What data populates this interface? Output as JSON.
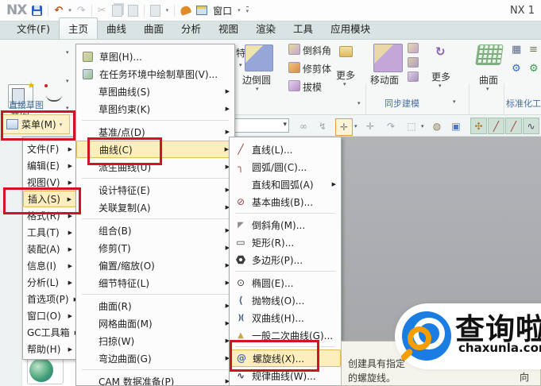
{
  "titlebar": {
    "logo": "NX",
    "window_label": "窗口",
    "right_text": "NX 1"
  },
  "tabs": [
    {
      "label": "文件(F)"
    },
    {
      "label": "主页",
      "active": true
    },
    {
      "label": "曲线"
    },
    {
      "label": "曲面"
    },
    {
      "label": "分析"
    },
    {
      "label": "视图"
    },
    {
      "label": "渲染"
    },
    {
      "label": "工具"
    },
    {
      "label": "应用模块"
    }
  ],
  "ribbon": {
    "sketch": "草图",
    "direct_sketch_group": "直接草图",
    "feature_partial": "特征",
    "edge_blend": "边倒圆",
    "chamfer": "倒斜角",
    "trim_body": "修剪体",
    "draft": "拔模",
    "more": "更多",
    "move_face": "移动面",
    "more2": "更多",
    "sync_group": "同步建模",
    "surface": "曲面",
    "std_group": "标准化工具"
  },
  "menu_button": "菜单(M)",
  "main_menu": {
    "items": [
      {
        "label": "文件(F)",
        "arrow": true
      },
      {
        "label": "编辑(E)",
        "arrow": true
      },
      {
        "label": "视图(V)",
        "arrow": true
      },
      {
        "label": "插入(S)",
        "arrow": true,
        "highlight": true
      },
      {
        "label": "格式(R)",
        "arrow": true
      },
      {
        "label": "工具(T)",
        "arrow": true
      },
      {
        "label": "装配(A)",
        "arrow": true
      },
      {
        "label": "信息(I)",
        "arrow": true
      },
      {
        "label": "分析(L)",
        "arrow": true
      },
      {
        "label": "首选项(P)",
        "arrow": true
      },
      {
        "label": "窗口(O)",
        "arrow": true
      },
      {
        "label": "GC工具箱",
        "arrow": true
      },
      {
        "label": "帮助(H)",
        "arrow": true
      }
    ]
  },
  "insert_menu": {
    "items": [
      {
        "label": "草图(H)...",
        "icon": "sketch"
      },
      {
        "label": "在任务环境中绘制草图(V)...",
        "icon": "sketch-task"
      },
      {
        "label": "草图曲线(S)",
        "arrow": true
      },
      {
        "label": "草图约束(K)",
        "arrow": true
      },
      {
        "type": "separator"
      },
      {
        "label": "基准/点(D)",
        "arrow": true
      },
      {
        "label": "曲线(C)",
        "arrow": true,
        "highlight": true
      },
      {
        "label": "派生曲线(U)",
        "arrow": true
      },
      {
        "type": "separator"
      },
      {
        "label": "设计特征(E)",
        "arrow": true
      },
      {
        "label": "关联复制(A)",
        "arrow": true
      },
      {
        "type": "separator"
      },
      {
        "label": "组合(B)",
        "arrow": true
      },
      {
        "label": "修剪(T)",
        "arrow": true
      },
      {
        "label": "偏置/缩放(O)",
        "arrow": true
      },
      {
        "label": "细节特征(L)",
        "arrow": true
      },
      {
        "type": "separator"
      },
      {
        "label": "曲面(R)",
        "arrow": true
      },
      {
        "label": "网格曲面(M)",
        "arrow": true
      },
      {
        "label": "扫掠(W)",
        "arrow": true
      },
      {
        "label": "弯边曲面(G)",
        "arrow": true
      },
      {
        "type": "separator"
      },
      {
        "label": "CAM 数据准备(P)",
        "arrow": true
      }
    ]
  },
  "curve_menu": {
    "items": [
      {
        "label": "直线(L)...",
        "icon": "line"
      },
      {
        "label": "圆弧/圆(C)...",
        "icon": "arc"
      },
      {
        "label": "直线和圆弧(A)",
        "arrow": true
      },
      {
        "label": "基本曲线(B)...",
        "icon": "basic-curve"
      },
      {
        "type": "separator"
      },
      {
        "label": "倒斜角(M)...",
        "icon": "chamfer"
      },
      {
        "label": "矩形(R)...",
        "icon": "rect"
      },
      {
        "label": "多边形(P)...",
        "icon": "polygon"
      },
      {
        "type": "separator"
      },
      {
        "label": "椭圆(E)...",
        "icon": "ellipse"
      },
      {
        "label": "抛物线(O)...",
        "icon": "parabola"
      },
      {
        "label": "双曲线(H)...",
        "icon": "hyperbola"
      },
      {
        "label": "一般二次曲线(G)...",
        "icon": "conic"
      },
      {
        "type": "separator"
      },
      {
        "label": "螺旋线(X)...",
        "icon": "helix",
        "highlight": true
      },
      {
        "label": "规律曲线(W)...",
        "icon": "law-curve"
      },
      {
        "type": "separator"
      }
    ]
  },
  "tooltip": {
    "line1_left": "创建具有指定",
    "line1_right": "，方向",
    "line2": "的螺旋线。"
  },
  "watermark": {
    "title": "查询啦",
    "domain": "chaxunla.com"
  },
  "colors": {
    "annotation_red": "#ce1620",
    "menu_highlight": "#fcefbc",
    "viewport_gray": "#a9abad",
    "group_label_blue": "#46719c",
    "watermark_blue": "#1b7ce2",
    "watermark_orange": "#f59e00"
  }
}
